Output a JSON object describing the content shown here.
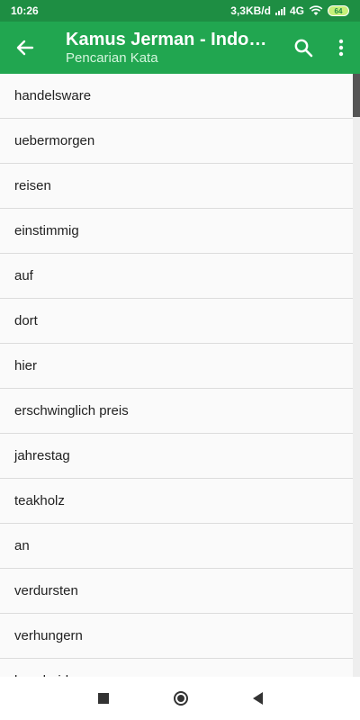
{
  "status_bar": {
    "time": "10:26",
    "net_speed": "3,3KB/d",
    "network": "4G",
    "battery": "64"
  },
  "app_bar": {
    "title": "Kamus Jerman - Indon…",
    "subtitle": "Pencarian Kata",
    "back_icon": "arrow-back-icon",
    "search_icon": "search-icon",
    "menu_icon": "more-vert-icon"
  },
  "words": [
    "handelsware",
    "uebermorgen",
    "reisen",
    "einstimmig",
    "auf",
    "dort",
    "hier",
    "erschwinglich preis",
    "jahrestag",
    "teakholz",
    "an",
    "verdursten",
    "verhungern",
    "bescheiden"
  ],
  "colors": {
    "app_bar": "#21a650",
    "status_bar": "#1e8e43"
  }
}
